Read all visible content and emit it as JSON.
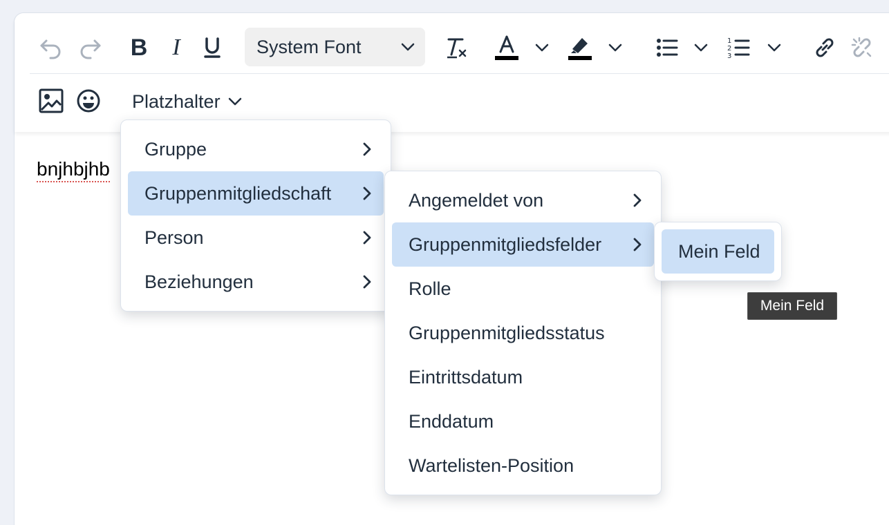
{
  "toolbar": {
    "font_family_value": "System Font",
    "placeholder_label": "Platzhalter",
    "icons": [
      "undo-icon",
      "redo-icon",
      "bold-icon",
      "italic-icon",
      "underline-icon",
      "clear-formatting-icon",
      "text-color-icon",
      "highlight-icon",
      "bullet-list-icon",
      "numbered-list-icon",
      "link-icon",
      "unlink-icon",
      "image-icon",
      "emoji-icon"
    ]
  },
  "content": {
    "text": "bnjhbjhb"
  },
  "menu1": {
    "items": [
      {
        "label": "Gruppe"
      },
      {
        "label": "Gruppenmitgliedschaft"
      },
      {
        "label": "Person"
      },
      {
        "label": "Beziehungen"
      }
    ]
  },
  "menu2": {
    "items": [
      {
        "label": "Angemeldet von"
      },
      {
        "label": "Gruppenmitgliedsfelder"
      },
      {
        "label": "Rolle"
      },
      {
        "label": "Gruppenmitgliedsstatus"
      },
      {
        "label": "Eintrittsdatum"
      },
      {
        "label": "Enddatum"
      },
      {
        "label": "Wartelisten-Position"
      }
    ]
  },
  "menu3": {
    "items": [
      {
        "label": "Mein Feld"
      }
    ]
  },
  "tooltip": {
    "text": "Mein Feld"
  },
  "colors": {
    "active_bg": "#cce0f7",
    "text": "#222f3e",
    "disabled": "#aab2bd"
  }
}
